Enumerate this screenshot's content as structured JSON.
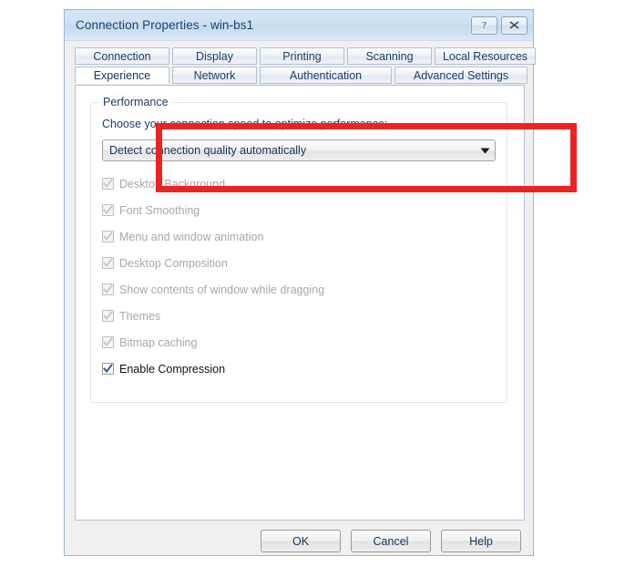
{
  "window": {
    "title": "Connection Properties - win-bs1",
    "help_button": "?",
    "close_button": "✕"
  },
  "tabs": {
    "row1": [
      {
        "label": "Connection",
        "selected": false
      },
      {
        "label": "Display",
        "selected": false
      },
      {
        "label": "Printing",
        "selected": false
      },
      {
        "label": "Scanning",
        "selected": false
      },
      {
        "label": "Local Resources",
        "selected": false
      }
    ],
    "row2": [
      {
        "label": "Experience",
        "selected": true
      },
      {
        "label": "Network",
        "selected": false
      },
      {
        "label": "Authentication",
        "selected": false
      },
      {
        "label": "Advanced Settings",
        "selected": false
      }
    ]
  },
  "performance": {
    "group_title": "Performance",
    "speed_label": "Choose your connection speed to optimize performance:",
    "connection_speed": {
      "selected": "Detect connection quality automatically"
    },
    "options": [
      {
        "label": "Desktop Background",
        "checked": true,
        "enabled": false
      },
      {
        "label": "Font Smoothing",
        "checked": true,
        "enabled": false
      },
      {
        "label": "Menu and window animation",
        "checked": true,
        "enabled": false
      },
      {
        "label": "Desktop Composition",
        "checked": true,
        "enabled": false
      },
      {
        "label": "Show contents of window while dragging",
        "checked": true,
        "enabled": false
      },
      {
        "label": "Themes",
        "checked": true,
        "enabled": false
      },
      {
        "label": "Bitmap caching",
        "checked": true,
        "enabled": false
      },
      {
        "label": "Enable Compression",
        "checked": true,
        "enabled": true
      }
    ]
  },
  "footer": {
    "ok": "OK",
    "cancel": "Cancel",
    "help": "Help"
  },
  "colors": {
    "annotation": "#ee2222",
    "title_text": "#16427a",
    "disabled_text": "#a8a8a8",
    "enabled_text": "#111111",
    "checkmark_enabled": "#2c5aa0",
    "checkmark_disabled": "#c4c4c4"
  }
}
